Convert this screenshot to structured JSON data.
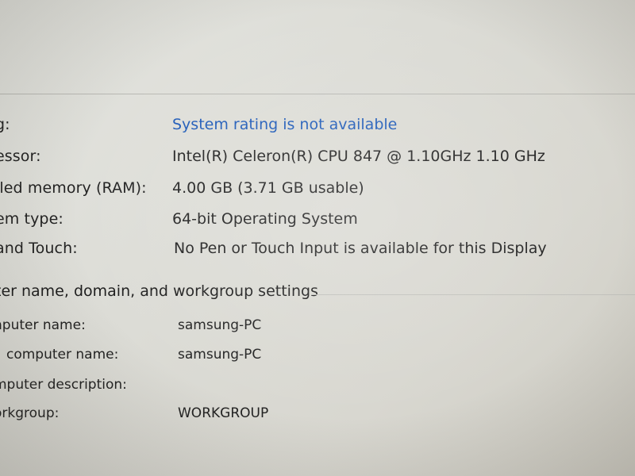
{
  "system": {
    "rows": [
      {
        "label": "g:",
        "value": "System rating is not available"
      },
      {
        "label": "essor:",
        "value": "Intel(R) Celeron(R) CPU 847 @ 1.10GHz  1.10 GHz"
      },
      {
        "label": "lled memory (RAM):",
        "value": "4.00 GB (3.71 GB usable)"
      },
      {
        "label": "em type:",
        "value": "64-bit Operating System"
      },
      {
        "label": "and Touch:",
        "value": "No Pen or Touch Input is available for this Display"
      }
    ]
  },
  "computer_settings": {
    "title": "ter name, domain, and workgroup settings",
    "rows": [
      {
        "label": "nputer name:",
        "value": "samsung-PC"
      },
      {
        "label": "computer name:",
        "value": "samsung-PC"
      },
      {
        "label": "mputer description:",
        "value": ""
      },
      {
        "label": "orkgroup:",
        "value": "WORKGROUP"
      }
    ]
  },
  "colors": {
    "link": "#1f5bb8",
    "text": "#222222",
    "background": "#dcdcd6"
  }
}
